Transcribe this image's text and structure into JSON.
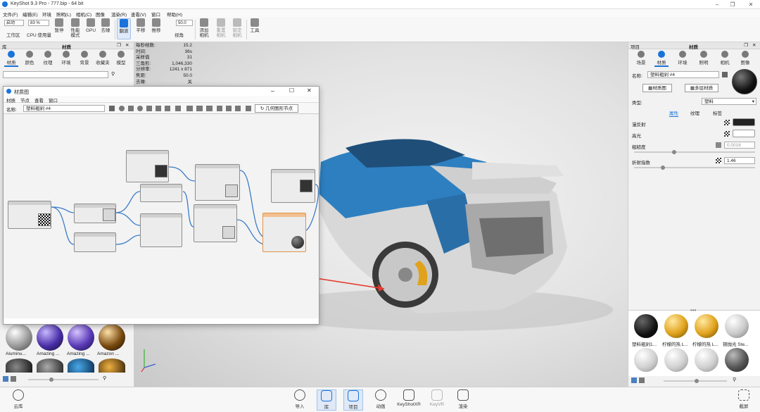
{
  "window": {
    "title": "KeyShot 9.3 Pro  - 777.bip  - 64 bit"
  },
  "menu": [
    "文件(F)",
    "编辑(E)",
    "环境",
    "照明(L)",
    "相机(C)",
    "图像",
    "渲染(R)",
    "查看(V)",
    "窗口",
    "帮助(H)"
  ],
  "toolbar": {
    "mode_select": "启动",
    "zoom_select": "83 %",
    "fov_value": "50.0",
    "items": [
      "工作区",
      "CPU 使用量",
      "暂停",
      "性能模式",
      "GPU",
      "去噪",
      "翻滚",
      "平移",
      "推移",
      "视角",
      "添加相机",
      "重置相机",
      "锁定相机",
      "工具"
    ]
  },
  "library": {
    "title": "库",
    "panel_title": "材质",
    "tabs": [
      "材质",
      "颜色",
      "纹理",
      "环境",
      "背景",
      "收藏夹",
      "模型"
    ],
    "swatch_labels": [
      "Aluminu...",
      "Amazing ...",
      "Amazing ...",
      "Amazon ..."
    ]
  },
  "stats": {
    "labels": [
      "每秒帧数:",
      "时间:",
      "采样值",
      "三角形:",
      "分辨率:",
      "焦距:",
      "去噪:"
    ],
    "values": [
      "15.2",
      "36s",
      "31",
      "1,046,330",
      "1241 x 871",
      "50.0",
      "关"
    ]
  },
  "node_editor": {
    "title": "材质图",
    "menu": [
      "材质",
      "节点",
      "查看",
      "窗口"
    ],
    "name_label": "名称:",
    "name_value": "塑料粗剁 #4",
    "geo_button": "几何图形节点"
  },
  "right_panel": {
    "title": "项目",
    "panel_title": "材质",
    "tabs": [
      "场景",
      "材质",
      "环境",
      "照明",
      "相机",
      "图像"
    ],
    "name_label": "名称:",
    "name_value": "塑料粗剁 #4",
    "graph_button": "材质图",
    "multi_button": "多层材质",
    "type_label": "类型:",
    "type_value": "塑料",
    "subtabs": [
      "属性",
      "纹理",
      "标签"
    ],
    "props": [
      "漫反射",
      "高光",
      "粗糙度",
      "折射指数"
    ],
    "roughness_value": "0.0016",
    "ior_value": "1.46",
    "thumb_labels": [
      "塑料粗剁1...",
      "柠檬的热 L...",
      "柠檬的热 L...",
      "铜抛光 Ste..."
    ]
  },
  "bottom": {
    "left_label": "云库",
    "items": [
      "导入",
      "库",
      "项目",
      "动画",
      "KeyShotXR",
      "KeyVR",
      "渲染"
    ],
    "right_label": "截屏"
  },
  "colors": {
    "accent": "#1a73d9",
    "car_blue": "#2d7fc0"
  }
}
